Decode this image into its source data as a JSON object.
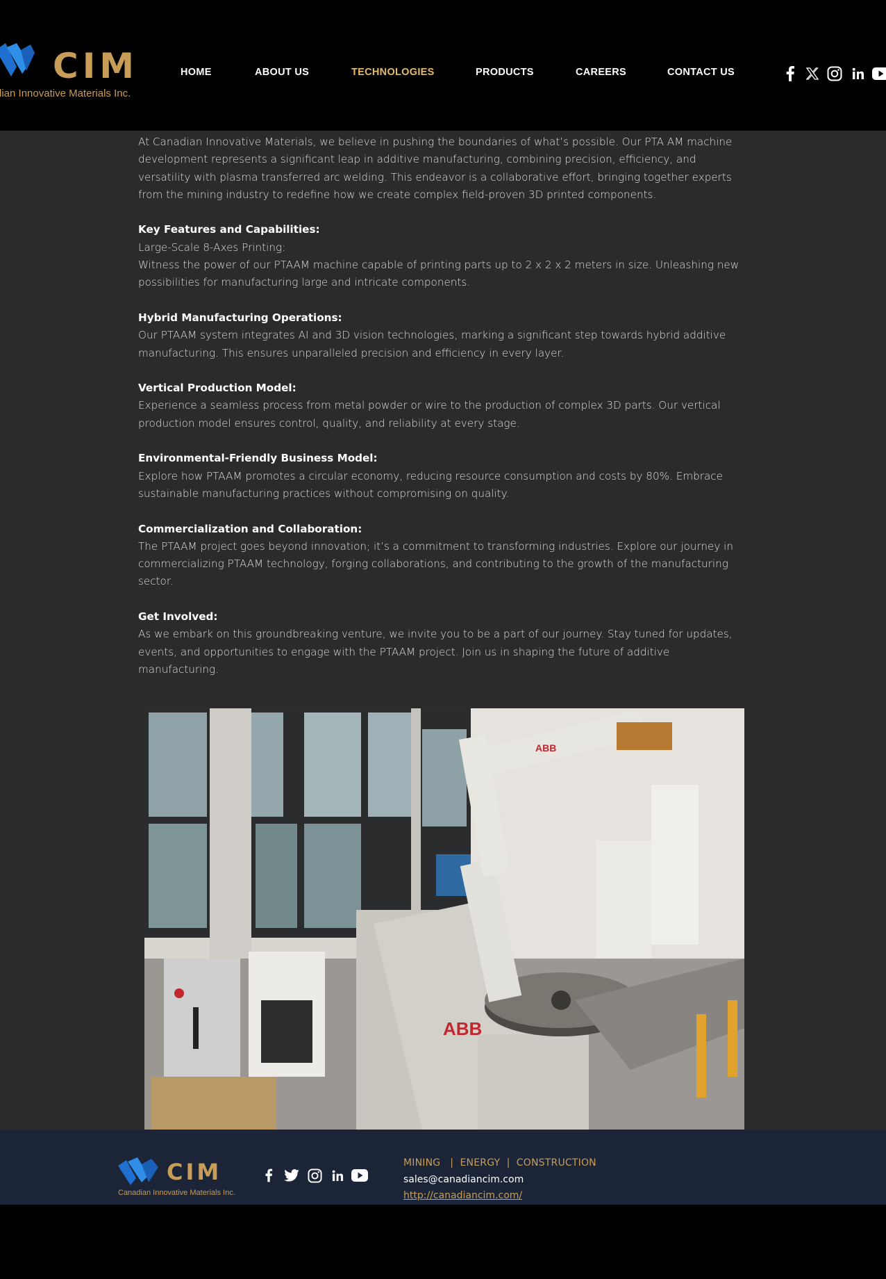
{
  "header": {
    "logo": {
      "word": "CIM",
      "tagline": "dian Innovative Materials Inc."
    },
    "nav": [
      {
        "label": "HOME",
        "active": false
      },
      {
        "label": "ABOUT US",
        "active": false
      },
      {
        "label": "TECHNOLOGIES",
        "active": true
      },
      {
        "label": "PRODUCTS",
        "active": false
      },
      {
        "label": "CAREERS",
        "active": false
      },
      {
        "label": "CONTACT US",
        "active": false
      }
    ],
    "social_icons": [
      "facebook-icon",
      "x-icon",
      "instagram-icon",
      "linkedin-icon",
      "youtube-icon"
    ]
  },
  "colors": {
    "accent_gold": "#c79d57",
    "nav_active": "#e3bb73",
    "body_bg": "#2b2b2b",
    "footer_bg": "#1c2438"
  },
  "content": {
    "intro": "At Canadian Innovative Materials, we believe in pushing the boundaries of what’s possible. Our PTA AM machine development represents a significant leap in additive manufacturing, combining precision, efficiency, and versatility with plasma transferred arc welding. This endeavor is a collaborative effort, bringing together experts from the mining industry to redefine how we create complex field-proven 3D printed components.",
    "key_features_heading": "Key Features and Capabilities:",
    "large_scale": {
      "subheading": "Large-Scale 8-Axes Printing:",
      "text": "Witness the power of our PTAAM machine capable of printing parts up to 2 x 2 x 2 meters in size. Unleashing new possibilities for manufacturing large and intricate components."
    },
    "sections": [
      {
        "heading": "Hybrid Manufacturing Operations:",
        "text": "Our PTAAM system integrates AI and 3D vision technologies, marking a significant step towards hybrid additive manufacturing. This ensures unparalleled precision and efficiency in every layer."
      },
      {
        "heading": "Vertical Production Model:",
        "text": "Experience a seamless process from metal powder or wire to the production of complex 3D parts. Our vertical production model ensures control, quality, and reliability at every stage."
      },
      {
        "heading": "Environmental-Friendly Business Model:",
        "text": "Explore how PTAAM promotes a circular economy, reducing resource consumption and costs by 80%. Embrace sustainable manufacturing practices without compromising on quality."
      },
      {
        "heading": "Commercialization and Collaboration:",
        "text": "The PTAAM project goes beyond innovation; it’s a commitment to transforming industries. Explore our journey in commercializing PTAAM technology, forging collaborations, and contributing to the growth of the manufacturing sector."
      },
      {
        "heading": "Get Involved:",
        "text": "As we embark on this groundbreaking venture, we invite you to be a part of our journey. Stay tuned for updates, events, and opportunities to engage with the PTAAM project. Join us in shaping the future of additive manufacturing."
      }
    ],
    "photo_robot_label": "ABB"
  },
  "footer": {
    "logo": {
      "word": "CIM",
      "tagline": "Canadian Innovative Materials Inc."
    },
    "social_icons": [
      "facebook-icon",
      "twitter-icon",
      "instagram-icon",
      "linkedin-icon",
      "youtube-icon"
    ],
    "tagline": "MINING   |  ENERGY  |  CONSTRUCTION",
    "email": "sales@canadiancim.com",
    "url": "http://canadiancim.com/"
  }
}
